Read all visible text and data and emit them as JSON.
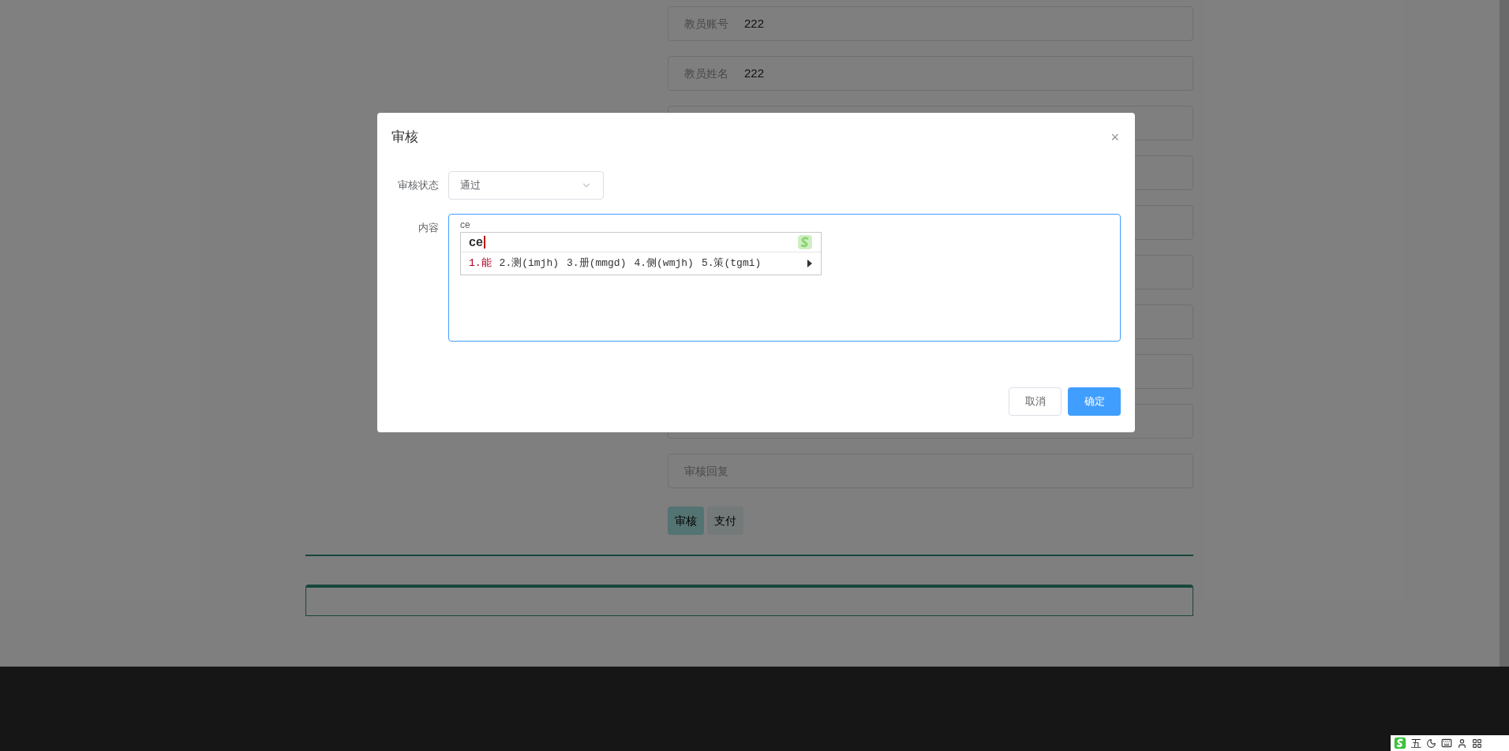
{
  "page": {
    "fields": [
      {
        "label": "教员账号",
        "value": "222"
      },
      {
        "label": "教员姓名",
        "value": "222"
      }
    ],
    "reply_field": {
      "placeholder": "审核回复"
    },
    "buttons": [
      {
        "label": "审核",
        "selected": true
      },
      {
        "label": "支付",
        "selected": false
      }
    ]
  },
  "dialog": {
    "title": "审核",
    "close": "×",
    "status_label": "审核状态",
    "status_value": "通过",
    "content_label": "内容",
    "content_value": "ce",
    "ime": {
      "composition": "ce",
      "candidates": [
        {
          "label": "1.能",
          "selected": true
        },
        {
          "label": "2.测(imjh)",
          "selected": false
        },
        {
          "label": "3.册(mmgd)",
          "selected": false
        },
        {
          "label": "4.侧(wmjh)",
          "selected": false
        },
        {
          "label": "5.策(tgmi)",
          "selected": false
        }
      ]
    },
    "buttons": [
      {
        "label": "取消",
        "kind": "default"
      },
      {
        "label": "确定",
        "kind": "primary"
      }
    ]
  },
  "ime_status_bar": {
    "mode": "五"
  }
}
